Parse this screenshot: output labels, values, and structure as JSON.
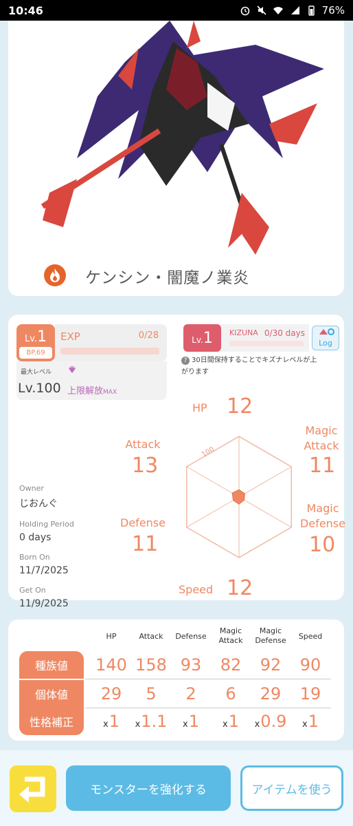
{
  "status_bar": {
    "time": "10:46",
    "battery": "76%"
  },
  "monster": {
    "name": "ケンシン・闇魔ノ業炎",
    "element_icon": "fire-icon"
  },
  "level": {
    "lv_prefix": "Lv.",
    "lv_value": "1",
    "bp": "BP.69",
    "exp_label": "EXP",
    "exp_value": "0/28"
  },
  "max_level": {
    "label": "最大レベル",
    "value": "Lv.100",
    "limit": "上限解放",
    "limit_suffix": "MAX"
  },
  "kizuna": {
    "lv_prefix": "Lv.",
    "lv_value": "1",
    "label": "KIZUNA",
    "value": "0/30 days",
    "log": "Log",
    "note": "30日間保持することでキズナレベルが上がります"
  },
  "radar": {
    "scale_label": "100",
    "max": 100
  },
  "stats": {
    "hp": {
      "label": "HP",
      "value": "12"
    },
    "magic_attack": {
      "label": "Magic Attack",
      "value": "11"
    },
    "magic_defense": {
      "label": "Magic Defense",
      "value": "10"
    },
    "speed": {
      "label": "Speed",
      "value": "12"
    },
    "defense": {
      "label": "Defense",
      "value": "11"
    },
    "attack": {
      "label": "Attack",
      "value": "13"
    }
  },
  "owner": {
    "owner_label": "Owner",
    "owner_value": "じおんぐ",
    "holding_label": "Holding Period",
    "holding_value": "0 days",
    "born_label": "Born On",
    "born_value": "11/7/2025",
    "get_label": "Get On",
    "get_value": "11/9/2025"
  },
  "table": {
    "headers": [
      "HP",
      "Attack",
      "Defense",
      "Magic Attack",
      "Magic Defense",
      "Speed"
    ],
    "rows": [
      {
        "label": "種族値",
        "values": [
          "140",
          "158",
          "93",
          "82",
          "92",
          "90"
        ]
      },
      {
        "label": "個体値",
        "values": [
          "29",
          "5",
          "2",
          "6",
          "29",
          "19"
        ]
      },
      {
        "label": "性格補正",
        "prefix": "x",
        "values": [
          "1",
          "1.1",
          "1",
          "1",
          "0.9",
          "1"
        ]
      }
    ]
  },
  "buttons": {
    "back": "back-arrow-icon",
    "enhance": "モンスターを強化する",
    "use_item": "アイテムを使う"
  }
}
